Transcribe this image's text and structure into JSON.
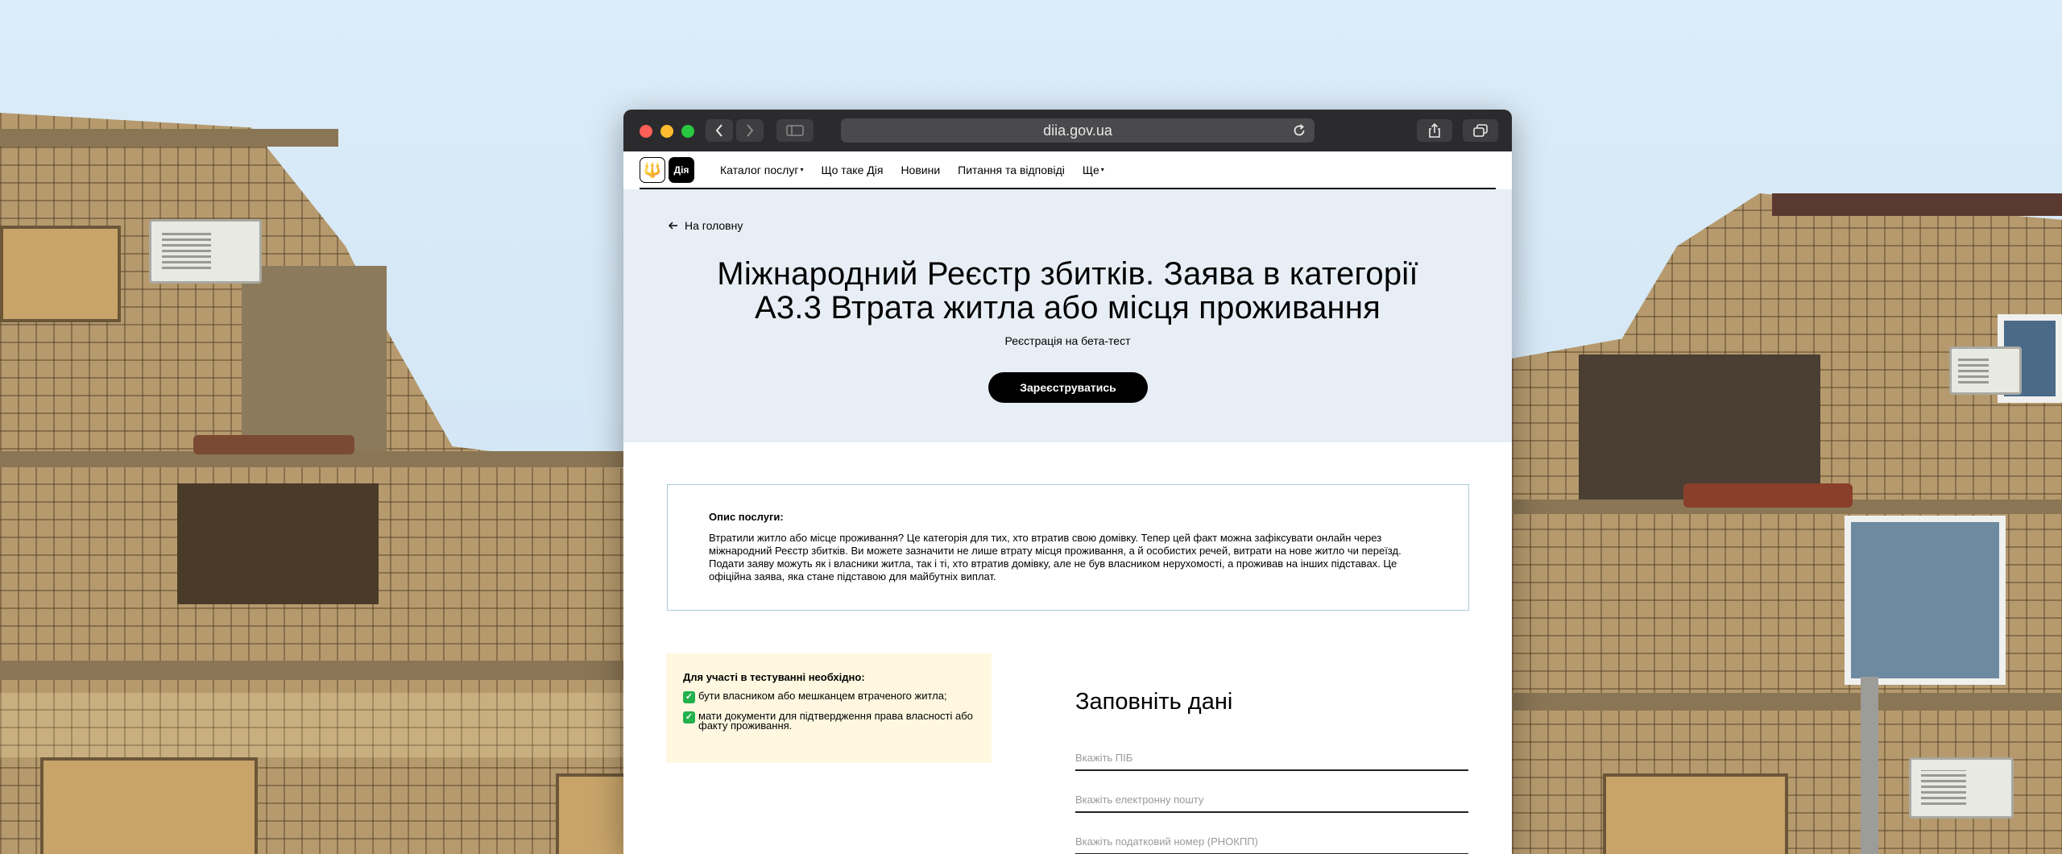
{
  "browser": {
    "url": "diia.gov.ua"
  },
  "site": {
    "logo_trident": "🔱",
    "logo_text": "Дія",
    "nav": [
      {
        "label": "Каталог послуг",
        "dropdown": true
      },
      {
        "label": "Що таке Дія",
        "dropdown": false
      },
      {
        "label": "Новини",
        "dropdown": false
      },
      {
        "label": "Питання та відповіді",
        "dropdown": false
      },
      {
        "label": "Ще",
        "dropdown": true
      }
    ],
    "dropdown_caret": "▾"
  },
  "hero": {
    "back_label": "На головну",
    "title_line1": "Міжнародний Реєстр збитків. Заява в категорії",
    "title_line2": "А3.3 Втрата житла або місця проживання",
    "subtitle": "Реєстрація на бета-тест",
    "cta_label": "Зареєструватись"
  },
  "description": {
    "title": "Опис послуги:",
    "text": "Втратили житло або місце проживання? Це категорія для тих, хто втратив свою домівку. Тепер цей факт можна зафіксувати онлайн через міжнародний Реєстр збитків. Ви можете зазначити не лише втрату місця проживання, а й особистих речей, витрати на нове житло чи переїзд. Подати заяву можуть як і власники житла, так і ті, хто втратив домівку, але не був власником нерухомості, а проживав на інших підставах. Це офіційна заява, яка стане підставою для майбутніх виплат."
  },
  "requirements": {
    "title": "Для участі в тестуванні необхідно:",
    "check_glyph": "✓",
    "items": [
      "бути власником або мешканцем втраченого житла;",
      "мати документи для підтвердження права власності або факту проживання."
    ]
  },
  "form": {
    "title": "Заповніть дані",
    "fields": [
      {
        "placeholder": "Вкажіть ПІБ",
        "value": ""
      },
      {
        "placeholder": "Вкажіть електронну пошту",
        "value": ""
      },
      {
        "placeholder": "Вкажіть податковий номер (РНОКПП)",
        "value": ""
      }
    ]
  },
  "colors": {
    "hero_bg": "#e8eef5",
    "cta_bg": "#000000",
    "requirements_bg": "#fff7e0",
    "description_border": "#a9cfd6",
    "check_green": "#22b14c"
  }
}
